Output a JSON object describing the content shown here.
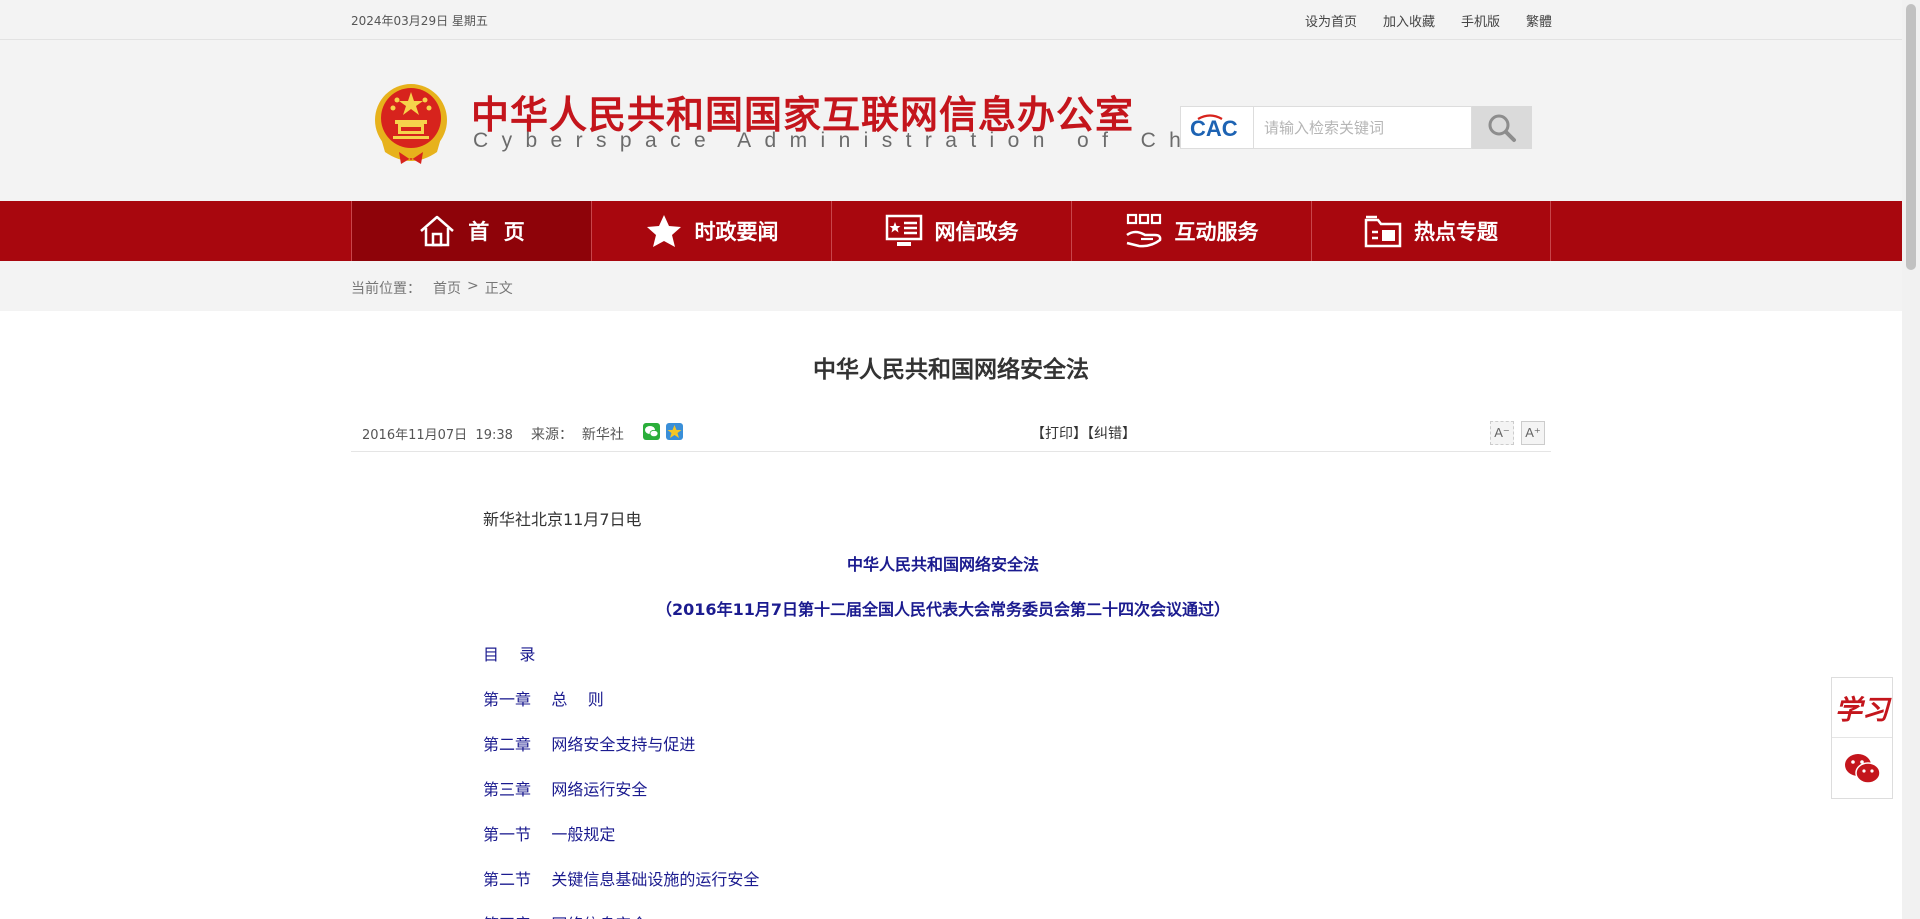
{
  "topbar": {
    "date": "2024年03月29日  星期五",
    "links": [
      "设为首页",
      "加入收藏",
      "手机版",
      "繁體"
    ]
  },
  "header": {
    "title": "中华人民共和国国家互联网信息办公室",
    "subtitle_en": "Cyberspace Administration of China",
    "emblem_icon": "national-emblem-icon",
    "search": {
      "logo_text": "CAC",
      "placeholder": "请输入检索关键词"
    }
  },
  "nav": {
    "items": [
      {
        "label": "首  页",
        "icon": "home-icon"
      },
      {
        "label": "时政要闻",
        "icon": "star-icon"
      },
      {
        "label": "网信政务",
        "icon": "monitor-icon"
      },
      {
        "label": "互动服务",
        "icon": "service-icon"
      },
      {
        "label": "热点专题",
        "icon": "folder-icon"
      }
    ],
    "colors": {
      "bar": "#a8070e",
      "active": "#8e0309"
    }
  },
  "breadcrumb": {
    "label": "当前位置：",
    "home": "首页",
    "sep": ">",
    "current": "正文"
  },
  "article": {
    "title": "中华人民共和国网络安全法",
    "time": "2016年11月07日  19:38",
    "source_label": "来源：  新华社",
    "print": "【打印】",
    "correct": "【纠错】",
    "font_small": "A⁻",
    "font_large": "A⁺",
    "lead": "新华社北京11月7日电",
    "law_title": "中华人民共和国网络安全法",
    "law_subtitle": "（2016年11月7日第十二届全国人民代表大会常务委员会第二十四次会议通过）",
    "toc": [
      "目    录",
      "第一章    总    则",
      "第二章    网络安全支持与促进",
      "第三章    网络运行安全",
      "第一节    一般规定",
      "第二节    关键信息基础设施的运行安全",
      "第四章    网络信息安全"
    ]
  },
  "side": {
    "xuexi": "学习",
    "wechat_icon": "wechat-icon"
  }
}
